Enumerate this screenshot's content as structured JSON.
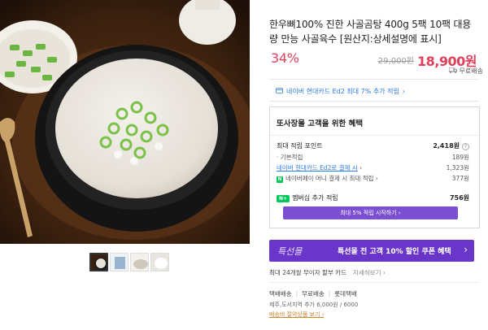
{
  "product": {
    "title": "한우뼈100% 진한 사골곰탕 400g 5팩 10팩 대용량 만능 사골육수 [원산지:상세설명에 표시]",
    "discount_rate": "34%",
    "original_price": "29,000원",
    "sale_price": "18,900원",
    "shipping_badge": "무료배송"
  },
  "card_promo": {
    "text": "네이버 현대카드 Ed2 최대 7% 추가 적립",
    "chevron": "›"
  },
  "benefits": {
    "title": "또사장몰 고객을 위한 혜택",
    "max_points_label": "최대 적립 포인트",
    "max_points_value": "2,418원",
    "help_mark": "?",
    "basic_label": "· 기본적립",
    "basic_value": "189원",
    "card_label": "네이버 현대카드 Ed2로 결제 시",
    "card_value": "1,323원",
    "card_chev": "›",
    "npay_label": "네이버페이 머니 결제 시 최대 적립",
    "npay_value": "377원",
    "npay_chev": "›",
    "npay_badge": "N",
    "member_badge": "N+",
    "member_label": "멤버십 추가 적립",
    "member_value": "756원",
    "member_button": "최대 5% 적립 시작하기",
    "member_button_chev": "›"
  },
  "banner": {
    "brand": "특선몰",
    "text": "특선몰 전 고객 10% 할인 쿠폰 혜택",
    "chev": "›"
  },
  "installment": {
    "text": "최대 24개월 무이자 할부 카드",
    "more": "자세히보기",
    "more_chev": "›"
  },
  "shipping": {
    "method": "택배배송",
    "fee": "무료배송",
    "carrier": "롯데택배",
    "jeju": "제주,도서지역 추가 6,000원 / 6000",
    "link": "배송비 절약상품 보기",
    "link_chev": "›"
  },
  "colors": {
    "accent_red": "#e0405a",
    "purple": "#6a35c9",
    "link_blue": "#2a7be4",
    "npay_green": "#03c75a"
  }
}
